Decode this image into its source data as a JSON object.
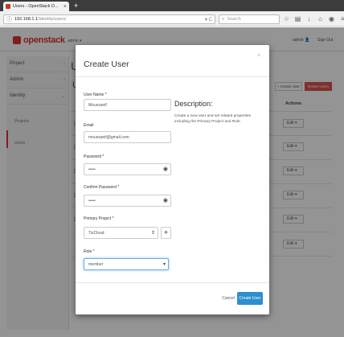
{
  "browser": {
    "tab_title": "Users - OpenStack D...",
    "url_host": "192.168.1.1",
    "url_path": "/identity/users/",
    "search_placeholder": "Search"
  },
  "header": {
    "logo_text": "openstack",
    "project_label": "admin ▾",
    "user_label": "admin 👤",
    "signout_label": "Sign Out"
  },
  "sidebar": {
    "items": [
      {
        "label": "Project"
      },
      {
        "label": "Admin"
      },
      {
        "label": "Identity"
      }
    ],
    "sub_items": [
      {
        "label": "Projects"
      },
      {
        "label": "Users"
      }
    ]
  },
  "background": {
    "title": "Us",
    "subtitle": "Us",
    "create_button": "+ Create User",
    "delete_button": "Delete Users",
    "col_enabled": "ed",
    "col_actions": "Actions",
    "edit_label": "Edit"
  },
  "modal": {
    "title": "Create User",
    "close": "×",
    "user_name_label": "User Name *",
    "user_name_value": "Moussanif",
    "email_label": "Email",
    "email_value": "moussanif@gmail.com",
    "password_label": "Password *",
    "password_value": "•••••",
    "confirm_label": "Confirm Password *",
    "confirm_value": "•••••",
    "project_label": "Primary Project *",
    "project_value": "TizCloud",
    "role_label": "Role *",
    "role_value": "member",
    "desc_title": "Description:",
    "desc_text": "Create a new user and set related properties including the Primary Project and Role.",
    "cancel_label": "Cancel",
    "create_label": "Create User"
  }
}
